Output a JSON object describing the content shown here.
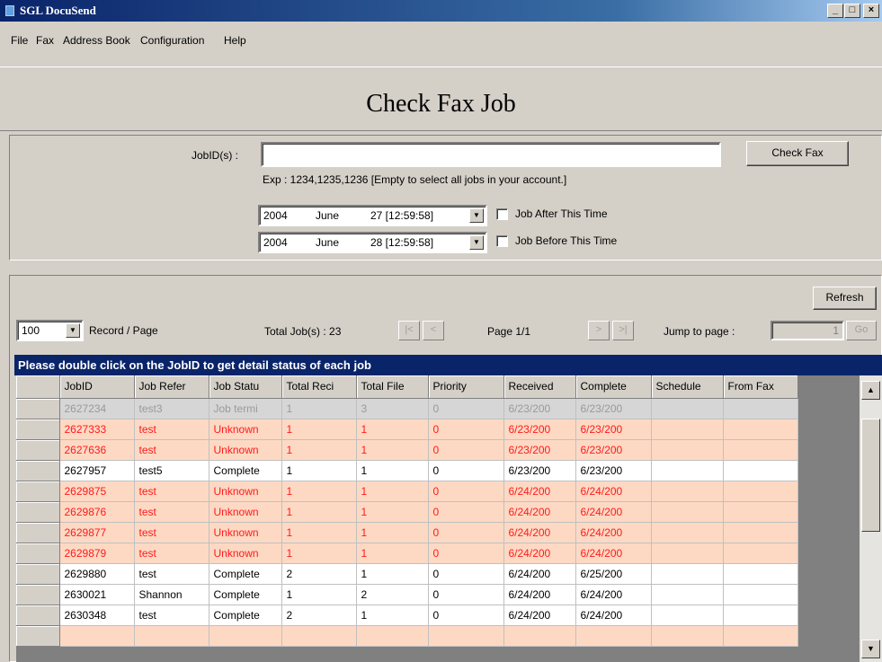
{
  "window": {
    "title": "SGL DocuSend",
    "min_glyph": "_",
    "max_glyph": "□",
    "close_glyph": "×"
  },
  "menu": [
    "File",
    "Fax",
    "Address Book",
    "Configuration",
    "Help"
  ],
  "page_title": "Check Fax Job",
  "search": {
    "jobid_label": "JobID(s) :",
    "jobid_value": "",
    "check_button": "Check Fax",
    "hint": "Exp : 1234,1235,1236 [Empty to select all jobs in your account.]",
    "after": {
      "year": "2004",
      "month": "June",
      "day_time": "27 [12:59:58]",
      "label": "Job After This Time",
      "checked": false
    },
    "before": {
      "year": "2004",
      "month": "June",
      "day_time": "28 [12:59:58]",
      "label": "Job Before This Time",
      "checked": false
    },
    "dropdown_glyph": "▼"
  },
  "list": {
    "refresh_button": "Refresh",
    "page_size": "100",
    "page_size_label": "Record / Page",
    "total_jobs": "Total Job(s) : 23",
    "nav_first": "|<",
    "nav_prev": "<",
    "page_info": "Page 1/1",
    "nav_next": ">",
    "nav_last": ">|",
    "jump_label": "Jump to page :",
    "jump_value": "1",
    "go_button": "Go",
    "banner": "Please double click on the JobID to get detail status of each job",
    "columns": [
      "JobID",
      "Job Refer",
      "Job Statu",
      "Total Reci",
      "Total File",
      "Priority",
      "Received",
      "Complete",
      "Schedule",
      "From Fax"
    ],
    "rows": [
      {
        "status": "term",
        "cells": [
          "2627234",
          "test3",
          "Job termi",
          "1",
          "3",
          "0",
          "6/23/200",
          "6/23/200",
          "",
          ""
        ]
      },
      {
        "status": "unknown",
        "cells": [
          "2627333",
          "test",
          "Unknown",
          "1",
          "1",
          "0",
          "6/23/200",
          "6/23/200",
          "",
          ""
        ]
      },
      {
        "status": "unknown",
        "cells": [
          "2627636",
          "test",
          "Unknown",
          "1",
          "1",
          "0",
          "6/23/200",
          "6/23/200",
          "",
          ""
        ]
      },
      {
        "status": "complete",
        "cells": [
          "2627957",
          "test5",
          "Complete",
          "1",
          "1",
          "0",
          "6/23/200",
          "6/23/200",
          "",
          ""
        ]
      },
      {
        "status": "unknown",
        "cells": [
          "2629875",
          "test",
          "Unknown",
          "1",
          "1",
          "0",
          "6/24/200",
          "6/24/200",
          "",
          ""
        ]
      },
      {
        "status": "unknown",
        "cells": [
          "2629876",
          "test",
          "Unknown",
          "1",
          "1",
          "0",
          "6/24/200",
          "6/24/200",
          "",
          ""
        ]
      },
      {
        "status": "unknown",
        "cells": [
          "2629877",
          "test",
          "Unknown",
          "1",
          "1",
          "0",
          "6/24/200",
          "6/24/200",
          "",
          ""
        ]
      },
      {
        "status": "unknown",
        "cells": [
          "2629879",
          "test",
          "Unknown",
          "1",
          "1",
          "0",
          "6/24/200",
          "6/24/200",
          "",
          ""
        ]
      },
      {
        "status": "complete",
        "cells": [
          "2629880",
          "test",
          "Complete",
          "2",
          "1",
          "0",
          "6/24/200",
          "6/25/200",
          "",
          ""
        ]
      },
      {
        "status": "complete",
        "cells": [
          "2630021",
          "Shannon",
          "Complete",
          "1",
          "2",
          "0",
          "6/24/200",
          "6/24/200",
          "",
          ""
        ]
      },
      {
        "status": "complete",
        "cells": [
          "2630348",
          "test",
          "Complete",
          "2",
          "1",
          "0",
          "6/24/200",
          "6/24/200",
          "",
          ""
        ]
      },
      {
        "status": "unknown",
        "cells": [
          "",
          "",
          "",
          "",
          "",
          "",
          "",
          "",
          "",
          ""
        ]
      }
    ],
    "scroll_up": "▲",
    "scroll_down": "▼"
  },
  "colors": {
    "banner": "#0a246a",
    "unknown_text": "#ff1a1a",
    "unknown_bg": "#fdd9c4",
    "term_text": "#9a9a9a"
  }
}
